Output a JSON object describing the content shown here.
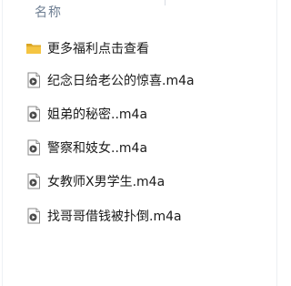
{
  "columns": {
    "name_header": "名称"
  },
  "items": [
    {
      "label": "更多福利点击查看",
      "type": "folder",
      "icon": "folder-icon"
    },
    {
      "label": "纪念日给老公的惊喜.m4a",
      "type": "audio",
      "icon": "audio-file-icon"
    },
    {
      "label": "姐弟的秘密..m4a",
      "type": "audio",
      "icon": "audio-file-icon"
    },
    {
      "label": "警察和妓女..m4a",
      "type": "audio",
      "icon": "audio-file-icon"
    },
    {
      "label": "女教师X男学生.m4a",
      "type": "audio",
      "icon": "audio-file-icon"
    },
    {
      "label": "找哥哥借钱被扑倒.m4a",
      "type": "audio",
      "icon": "audio-file-icon"
    }
  ],
  "colors": {
    "folder": "#f0c040",
    "folder_dark": "#d9a521",
    "audio_badge": "#5a5a5a",
    "header_text": "#6f7f93"
  }
}
